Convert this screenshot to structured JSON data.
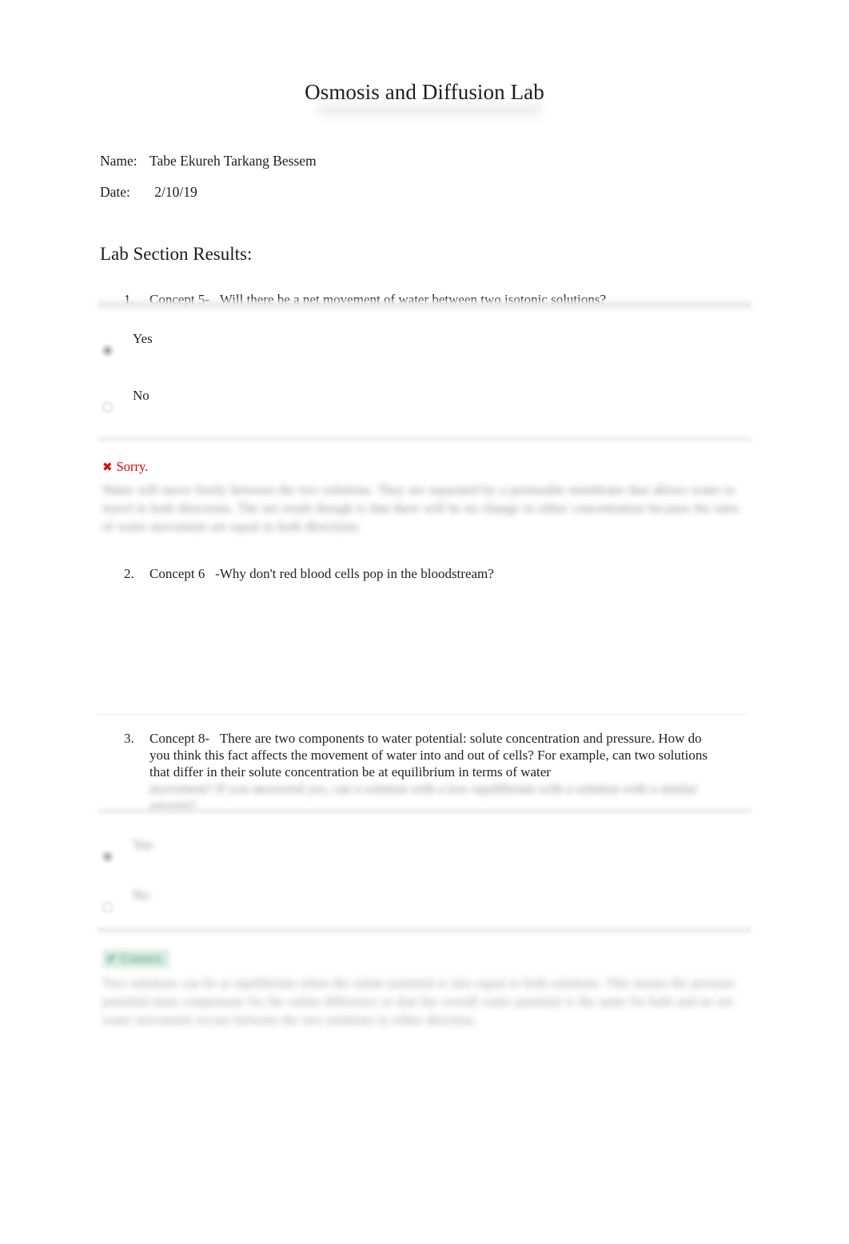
{
  "document": {
    "title": "Osmosis and Diffusion Lab",
    "fields": [
      {
        "label": "Name:",
        "value": "Tabe Ekureh Tarkang Bessem"
      },
      {
        "label": "Date:",
        "value": "2/10/19"
      }
    ],
    "section_heading": "Lab Section Results:"
  },
  "colors": {
    "incorrect": "#e60000",
    "correct_badge_bg": "#cfe9de",
    "correct_badge_text": "#2f7d62",
    "page_background": "#ffffff",
    "text": "#232323",
    "rule": "#e9e9ea"
  },
  "questions": [
    {
      "number": "1.",
      "concept": "Concept 5-",
      "prompt": "Will there be a net movement of water between two isotonic solutions?",
      "options": [
        {
          "label": "Yes",
          "selected": true
        },
        {
          "label": "No",
          "selected": false
        }
      ],
      "feedback": {
        "icon": "cross-mark-icon",
        "icon_glyph": "✖",
        "status": "Sorry.",
        "status_type": "incorrect",
        "explanation": "Water will move freely between the two solutions. They are separated by a permeable membrane that allows water to travel in both directions. The net result though is that there will be no change in either concentration because the rates of water movement are equal in both directions."
      }
    },
    {
      "number": "2.",
      "concept": "Concept 6",
      "prompt": "-Why don't red blood cells pop in the bloodstream?",
      "options": [],
      "answer": ""
    },
    {
      "number": "3.",
      "concept": "Concept 8-",
      "prompt": "There are two components to water potential: solute concentration and pressure. How do you think this fact affects the movement of water into and out of cells? For example, can two solutions that differ in their solute concentration be at equilibrium in terms of water",
      "prompt_redacted": "movement? If you answered yes, can a solution with a low equilibrium with a solution with a similar amount?",
      "options": [
        {
          "label": "Yes",
          "selected": true
        },
        {
          "label": "No",
          "selected": false
        }
      ],
      "feedback": {
        "icon": "check-mark-icon",
        "icon_glyph": "✔",
        "status": "Correct.",
        "status_type": "correct",
        "explanation": "Two solutions can be at equilibrium when the solute potential is also equal in both solutions. This means the pressure potential must compensate for the solute difference so that the overall water potential is the same for both and no net water movement occurs between the two solutions in either direction."
      }
    }
  ]
}
